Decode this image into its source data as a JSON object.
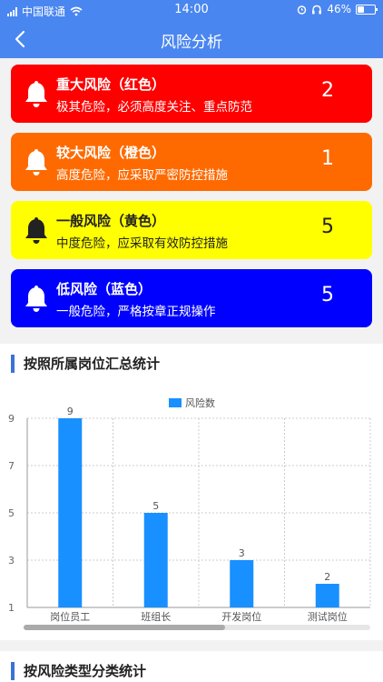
{
  "status_bar": {
    "carrier": "中国联通",
    "time": "14:00",
    "battery": "46%",
    "battery_level": 0.46
  },
  "nav": {
    "title": "风险分析",
    "back_icon": "chevron-left-icon"
  },
  "risk_cards": [
    {
      "title": "重大风险（红色）",
      "desc": "极其危险，必须高度关注、重点防范",
      "count": "2",
      "color": "#ff0000",
      "text_color": "#ffffff",
      "icon": "bell-icon"
    },
    {
      "title": "较大风险（橙色）",
      "desc": "高度危险，应采取严密防控措施",
      "count": "1",
      "color": "#ff6a00",
      "text_color": "#ffffff",
      "icon": "bell-icon"
    },
    {
      "title": "一般风险（黄色）",
      "desc": "中度危险，应采取有效防控措施",
      "count": "5",
      "color": "#ffff00",
      "text_color": "#222222",
      "icon": "bell-icon"
    },
    {
      "title": "低风险（蓝色）",
      "desc": "一般危险，严格按章正规操作",
      "count": "5",
      "color": "#0000ff",
      "text_color": "#ffffff",
      "icon": "bell-icon"
    }
  ],
  "section1": {
    "title": "按照所属岗位汇总统计"
  },
  "section2": {
    "title": "按风险类型分类统计"
  },
  "chart_data": {
    "type": "bar",
    "categories": [
      "岗位员工",
      "班组长",
      "开发岗位",
      "测试岗位"
    ],
    "series": [
      {
        "name": "风险数",
        "values": [
          9,
          5,
          3,
          2
        ],
        "color": "#1890ff"
      }
    ],
    "y_ticks": [
      1,
      3,
      5,
      7,
      9
    ],
    "ylim": [
      1,
      9
    ],
    "grid": true,
    "legend": "top-center"
  }
}
